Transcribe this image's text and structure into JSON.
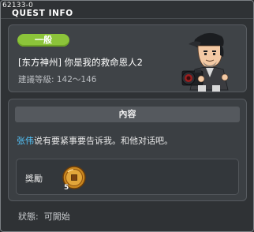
{
  "window": {
    "quest_id": "62133-0",
    "title": "QUEST INFO"
  },
  "quest": {
    "category_badge": "一般",
    "name": "[东方神州] 你是我的救命恩人2",
    "level_requirement": "建議等級: 142～146"
  },
  "content": {
    "section_title": "內容",
    "npc_name": "张伟",
    "dialog_rest": "说有要紧事要告诉我。和他对话吧。"
  },
  "reward": {
    "label": "獎勵",
    "item_icon": "gold-coin-icon",
    "item_count": "5"
  },
  "status": {
    "label": "狀態:",
    "value": "可開始"
  },
  "colors": {
    "badge": "#8cc43a",
    "npc_name": "#53c7ff",
    "panel": "#3f4347"
  }
}
